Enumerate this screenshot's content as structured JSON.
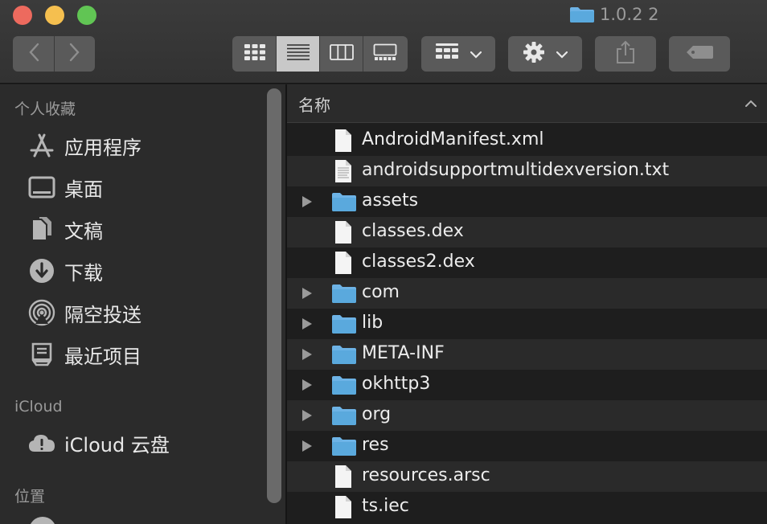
{
  "window": {
    "title": "1.0.2 2"
  },
  "toolbar": {
    "back": "back",
    "forward": "forward",
    "views": [
      "icon-view",
      "list-view",
      "column-view",
      "gallery-view"
    ],
    "active_view": "list-view"
  },
  "sidebar": {
    "favorites_title": "个人收藏",
    "favorites": [
      {
        "label": "应用程序",
        "icon": "applications-icon"
      },
      {
        "label": "桌面",
        "icon": "desktop-icon"
      },
      {
        "label": "文稿",
        "icon": "documents-icon"
      },
      {
        "label": "下载",
        "icon": "downloads-icon"
      },
      {
        "label": "隔空投送",
        "icon": "airdrop-icon"
      },
      {
        "label": "最近项目",
        "icon": "recents-icon"
      }
    ],
    "icloud_title": "iCloud",
    "icloud": [
      {
        "label": "iCloud 云盘",
        "icon": "icloud-drive-icon"
      }
    ],
    "locations_title": "位置"
  },
  "filelist": {
    "column_name": "名称",
    "rows": [
      {
        "name": "AndroidManifest.xml",
        "type": "file",
        "expandable": false
      },
      {
        "name": "androidsupportmultidexversion.txt",
        "type": "text",
        "expandable": false
      },
      {
        "name": "assets",
        "type": "folder",
        "expandable": true
      },
      {
        "name": "classes.dex",
        "type": "file",
        "expandable": false
      },
      {
        "name": "classes2.dex",
        "type": "file",
        "expandable": false
      },
      {
        "name": "com",
        "type": "folder",
        "expandable": true
      },
      {
        "name": "lib",
        "type": "folder",
        "expandable": true
      },
      {
        "name": "META-INF",
        "type": "folder",
        "expandable": true
      },
      {
        "name": "okhttp3",
        "type": "folder",
        "expandable": true
      },
      {
        "name": "org",
        "type": "folder",
        "expandable": true
      },
      {
        "name": "res",
        "type": "folder",
        "expandable": true
      },
      {
        "name": "resources.arsc",
        "type": "file",
        "expandable": false
      },
      {
        "name": "ts.iec",
        "type": "file",
        "expandable": false
      }
    ]
  },
  "colors": {
    "folder": "#5aa9dd",
    "sidebar_bg": "#2b2b2b",
    "list_bg": "#1e1e1e",
    "row_alt": "#2a2a2a"
  }
}
